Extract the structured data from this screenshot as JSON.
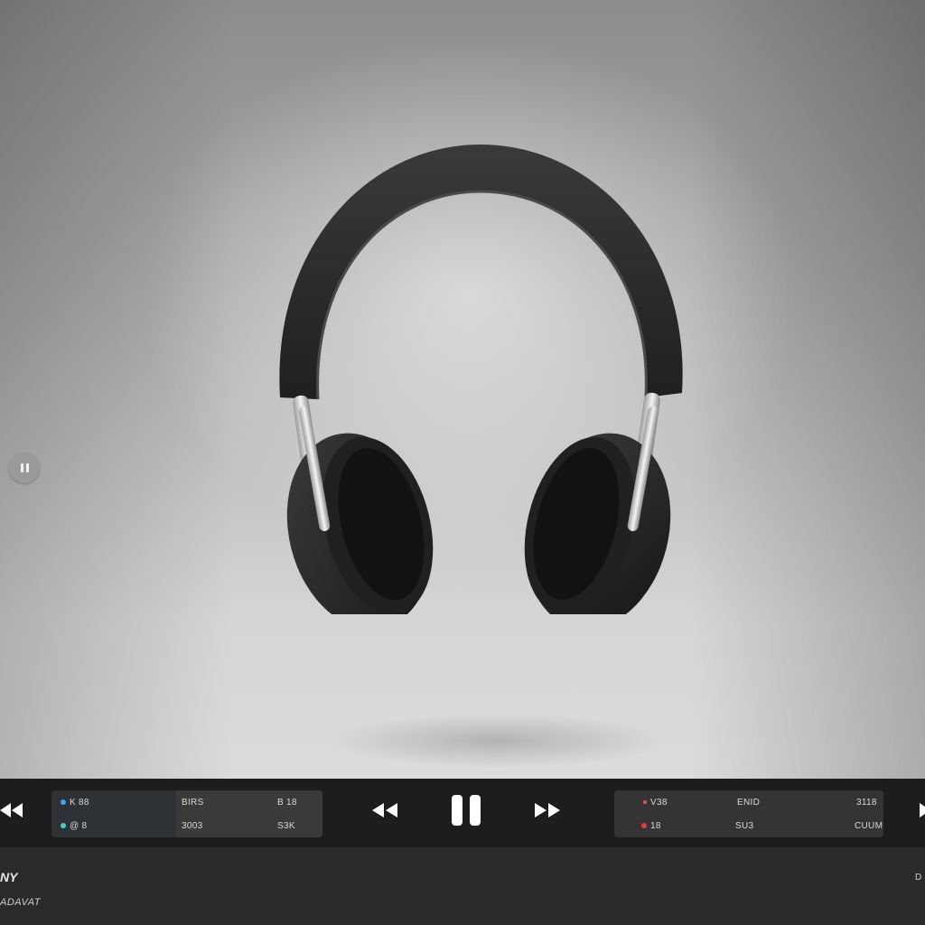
{
  "player": {
    "now_playing_title": "NY",
    "now_playing_subtitle": "ADAVAT",
    "right_edge_label": "D"
  },
  "panels": {
    "left": {
      "row1": [
        "K 88",
        "BIRS",
        "B 18"
      ],
      "row2": [
        "@ 8",
        "3003",
        "S3K"
      ],
      "row1_marker_color": "#3aa7e0",
      "row2_marker_color": "#3fd4c6"
    },
    "right": {
      "row1": [
        "V38",
        "ENID",
        "3118"
      ],
      "row2": [
        "18",
        "SU3",
        "CUUM"
      ],
      "row1_marker_color": "#e85050",
      "row2_marker_color": "#e04040",
      "row1_accent_color": "#3aa7e0"
    }
  },
  "controls": {
    "prev_icon": "rewind-icon",
    "pause_icon": "pause-icon",
    "next_icon": "fast-forward-icon",
    "side_pause_icon": "pause-icon"
  },
  "colors": {
    "transport_bg": "#1d1d1d",
    "bottom_bg": "#2a2a2a",
    "icon": "#ffffff"
  }
}
